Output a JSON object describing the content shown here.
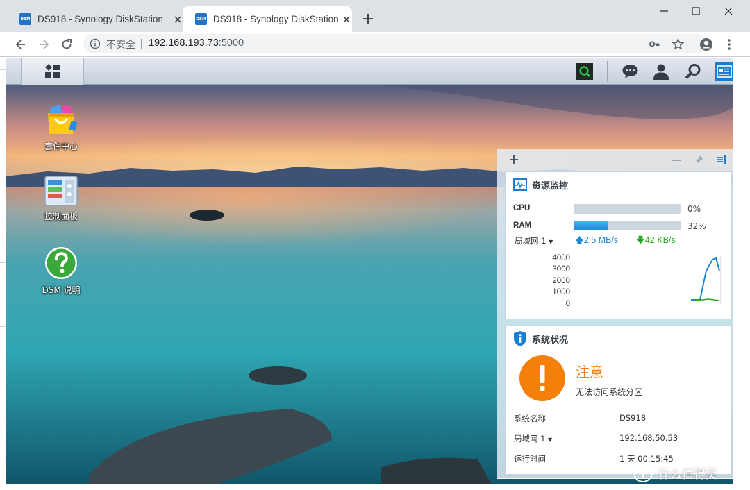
{
  "browser": {
    "tabs": [
      {
        "favicon": "DSM",
        "title": "DS918 - Synology DiskStation",
        "active": false
      },
      {
        "favicon": "DSM",
        "title": "DS918 - Synology DiskStation",
        "active": true
      }
    ],
    "address": {
      "security_label": "不安全",
      "host": "192.168.193.73",
      "port": ":5000"
    },
    "icons": [
      "back-icon",
      "forward-icon",
      "reload-icon",
      "info-icon",
      "key-icon",
      "star-icon",
      "account-icon",
      "menu-icon",
      "new-tab-icon"
    ]
  },
  "dsm": {
    "desktop_icons": [
      {
        "label": "套件中心",
        "icon": "package-center-icon"
      },
      {
        "label": "控制面板",
        "icon": "control-panel-icon"
      },
      {
        "label": "DSM 说明",
        "icon": "help-icon"
      }
    ],
    "taskbar_icons": [
      "main-menu-icon",
      "search-app-icon",
      "chat-icon",
      "user-icon",
      "search-icon",
      "widgets-icon"
    ],
    "resource_monitor": {
      "title": "资源监控",
      "cpu_label": "CPU",
      "cpu_value": "0%",
      "cpu_fraction": 0.0,
      "ram_label": "RAM",
      "ram_value": "32%",
      "ram_fraction": 0.32,
      "network_label": "局域网 1",
      "upload": "2.5 MB/s",
      "download": "42 KB/s",
      "chart_ticks": [
        "4000",
        "3000",
        "2000",
        "1000",
        "0"
      ],
      "upload_color": "#1a86d9",
      "download_color": "#2aa828"
    },
    "system_health": {
      "title": "系统状况",
      "status": "注意",
      "message": "无法访问系统分区",
      "status_color": "#f47f0b",
      "rows": [
        {
          "label": "系统名称",
          "value": "DS918"
        },
        {
          "label": "局域网 1",
          "value": "192.168.50.53"
        },
        {
          "label": "运行时间",
          "value": "1 天 00:15:45"
        }
      ]
    }
  },
  "watermark": "什么值得买"
}
